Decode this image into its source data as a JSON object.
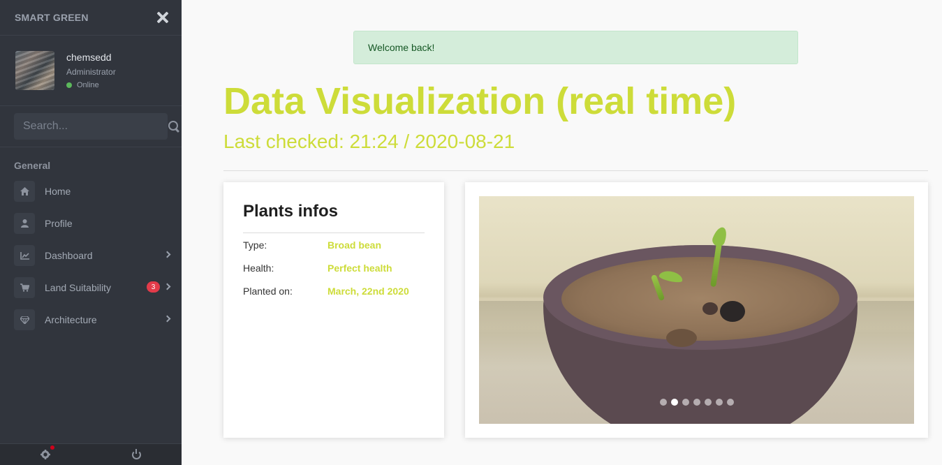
{
  "sidebar": {
    "brand": "SMART GREEN",
    "user": {
      "name": "chemsedd",
      "role": "Administrator",
      "status": "Online"
    },
    "search": {
      "placeholder": "Search..."
    },
    "section_title": "General",
    "items": [
      {
        "label": "Home",
        "icon": "home-icon"
      },
      {
        "label": "Profile",
        "icon": "user-icon"
      },
      {
        "label": "Dashboard",
        "icon": "chart-icon"
      },
      {
        "label": "Land Suitability",
        "icon": "cart-icon",
        "badge": "3"
      },
      {
        "label": "Architecture",
        "icon": "diamond-icon"
      }
    ]
  },
  "alert": {
    "message": "Welcome back!"
  },
  "header": {
    "title": "Data Visualization (real time)",
    "subtitle": "Last checked: 21:24 / 2020-08-21"
  },
  "plant_card": {
    "title": "Plants infos",
    "rows": [
      {
        "label": "Type:",
        "value": "Broad bean"
      },
      {
        "label": "Health:",
        "value": "Perfect health"
      },
      {
        "label": "Planted on:",
        "value": "March, 22nd 2020"
      }
    ]
  },
  "carousel": {
    "slide_count": 7,
    "active_index": 1
  },
  "colors": {
    "accent": "#cddc39",
    "sidebar_bg": "#31353d",
    "alert_bg": "#d4edda",
    "badge": "#e23b4a"
  }
}
